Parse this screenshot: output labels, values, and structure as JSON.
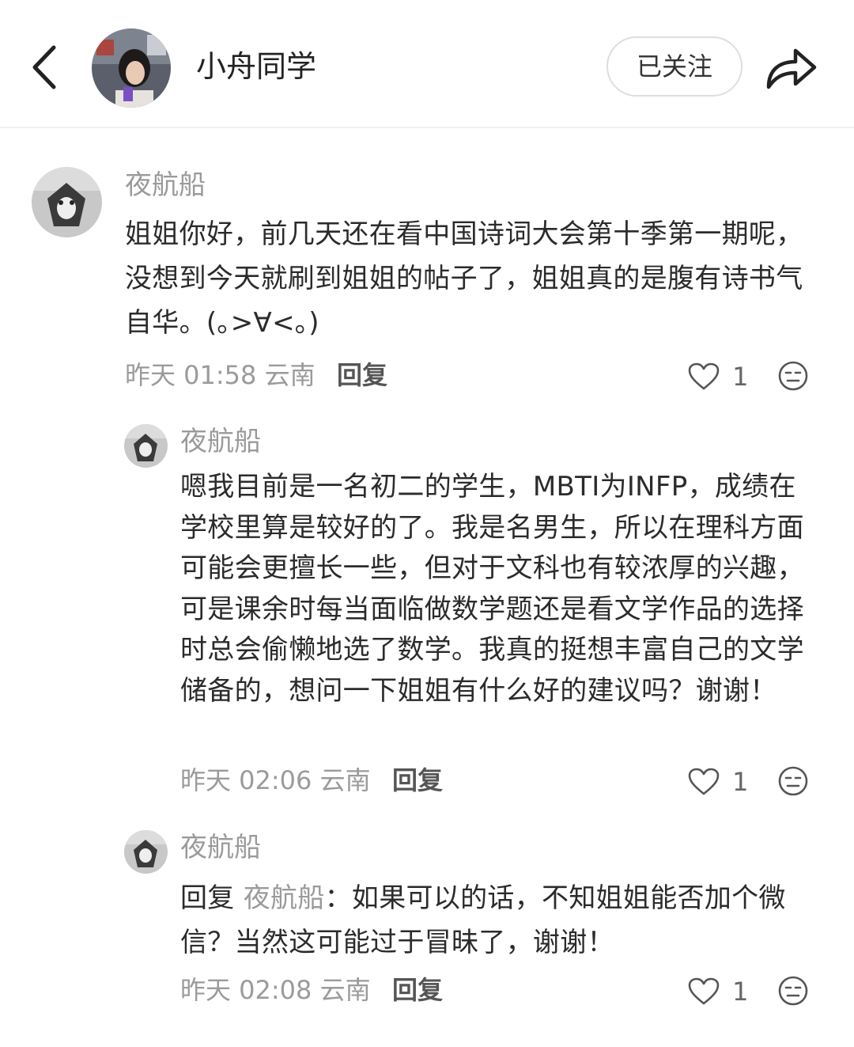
{
  "header": {
    "back_icon": "chevron-left-icon",
    "name": "小舟同学",
    "follow_label": "已关注",
    "share_icon": "share-arrow-icon"
  },
  "comments": [
    {
      "user": "夜航船",
      "text": "姐姐你好，前几天还在看中国诗词大会第十季第一期呢，没想到今天就刷到姐姐的帖子了，姐姐真的是腹有诗书气自华。(｡>∀<｡)",
      "time": "昨天 01:58",
      "location": "云南",
      "reply_label": "回复",
      "likes": "1"
    },
    {
      "user": "夜航船",
      "text": "嗯我目前是一名初二的学生，MBTI为INFP，成绩在学校里算是较好的了。我是名男生，所以在理科方面可能会更擅长一些，但对于文科也有较浓厚的兴趣，可是课余时每当面临做数学题还是看文学作品的选择时总会偷懒地选了数学。我真的挺想丰富自己的文学储备的，想问一下姐姐有什么好的建议吗？谢谢！",
      "time": "昨天 02:06",
      "location": "云南",
      "reply_label": "回复",
      "likes": "1"
    },
    {
      "user": "夜航船",
      "reply_prefix": "回复",
      "reply_to": "夜航船",
      "text": "：如果可以的话，不知姐姐能否加个微信？当然这可能过于冒昧了，谢谢！",
      "time": "昨天 02:08",
      "location": "云南",
      "reply_label": "回复",
      "likes": "1"
    }
  ]
}
